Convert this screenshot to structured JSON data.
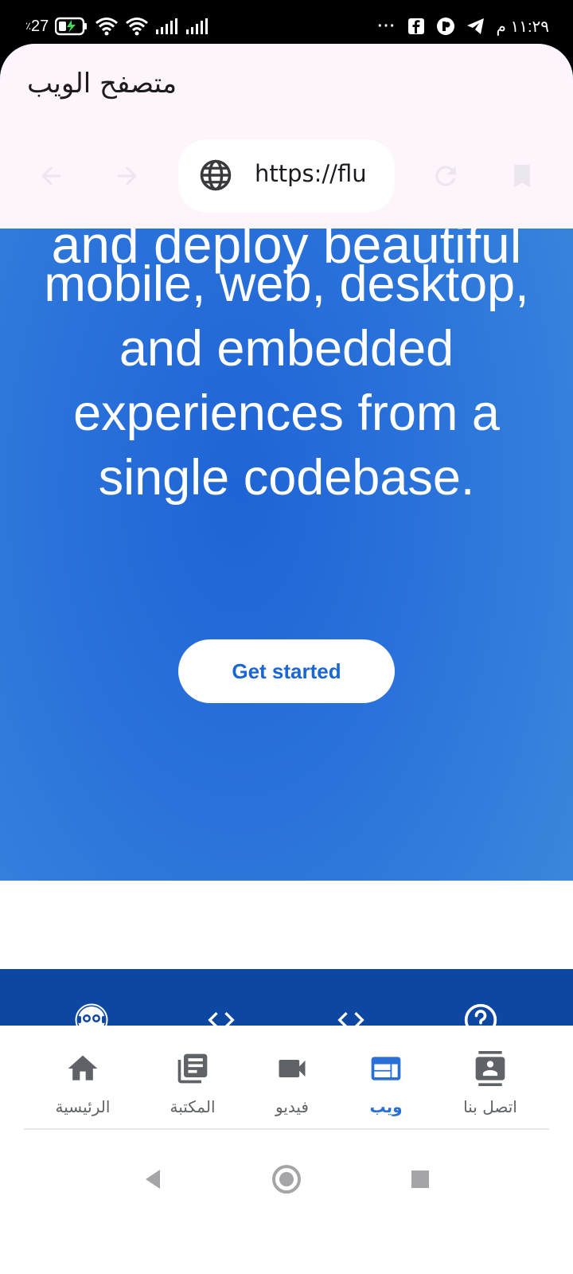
{
  "status_bar": {
    "battery_text": "27",
    "battery_prefix": "٪",
    "time": "١١:٢٩ م",
    "dots": "···"
  },
  "browser": {
    "title": "متصفح الويب",
    "url_value": "https://flu"
  },
  "hero": {
    "cut_line": "and deploy beautiful",
    "text": "mobile, web, desktop, and embedded experiences from a single codebase.",
    "cta_label": "Get started"
  },
  "bottom_nav": {
    "items": [
      {
        "label": "الرئيسية",
        "icon": "home-icon"
      },
      {
        "label": "المكتبة",
        "icon": "library-icon"
      },
      {
        "label": "فيديو",
        "icon": "video-icon"
      },
      {
        "label": "ويب",
        "icon": "web-icon",
        "active": true
      },
      {
        "label": "اتصل بنا",
        "icon": "contact-icon"
      }
    ]
  },
  "colors": {
    "accent": "#2a6fd6",
    "toolbar": "#0e47a1",
    "appbar": "#fdf5fb",
    "hero": "#2a72da"
  }
}
